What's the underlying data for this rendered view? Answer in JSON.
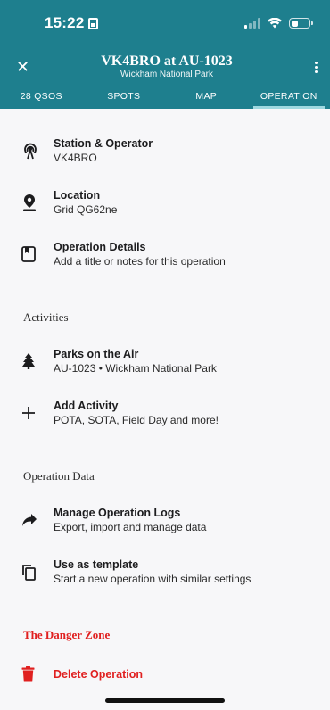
{
  "status": {
    "time": "15:22"
  },
  "header": {
    "title": "VK4BRO at AU-1023",
    "subtitle": "Wickham National Park"
  },
  "tabs": [
    {
      "label": "28 QSOS"
    },
    {
      "label": "SPOTS"
    },
    {
      "label": "MAP"
    },
    {
      "label": "OPERATION"
    }
  ],
  "active_tab": "OPERATION",
  "items": {
    "station": {
      "title": "Station & Operator",
      "subtitle": "VK4BRO"
    },
    "location": {
      "title": "Location",
      "subtitle": "Grid QG62ne"
    },
    "details": {
      "title": "Operation Details",
      "subtitle": "Add a title or notes for this operation"
    }
  },
  "sections": {
    "activities": "Activities",
    "operation_data": "Operation Data",
    "danger": "The Danger Zone"
  },
  "activities": {
    "pota": {
      "title": "Parks on the Air",
      "subtitle": "AU-1023 • Wickham National Park"
    },
    "add": {
      "title": "Add Activity",
      "subtitle": "POTA, SOTA, Field Day and more!"
    }
  },
  "operation_data": {
    "logs": {
      "title": "Manage Operation Logs",
      "subtitle": "Export, import and manage data"
    },
    "template": {
      "title": "Use as template",
      "subtitle": "Start a new operation with similar settings"
    }
  },
  "danger": {
    "delete_label": "Delete Operation"
  },
  "colors": {
    "header": "#1e7f8e",
    "danger": "#e02020",
    "tab_indicator": "#9fd8e0"
  }
}
